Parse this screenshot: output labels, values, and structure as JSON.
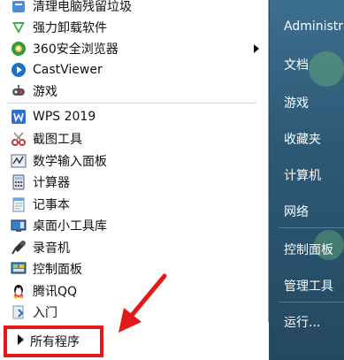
{
  "programs": [
    {
      "label": "清理电脑残留垃圾",
      "icon": "cleanup-icon"
    },
    {
      "label": "强力卸载软件",
      "icon": "uninstall-icon"
    },
    {
      "label": "360安全浏览器",
      "icon": "browser-360-icon"
    },
    {
      "label": "CastViewer",
      "icon": "castviewer-icon"
    },
    {
      "label": "游戏",
      "icon": "games-icon"
    },
    {
      "label": "WPS 2019",
      "icon": "wps-icon"
    },
    {
      "label": "截图工具",
      "icon": "snipping-tool-icon"
    },
    {
      "label": "数学输入面板",
      "icon": "math-input-icon"
    },
    {
      "label": "计算器",
      "icon": "calculator-icon"
    },
    {
      "label": "记事本",
      "icon": "notepad-icon"
    },
    {
      "label": "桌面小工具库",
      "icon": "gadgets-icon"
    },
    {
      "label": "录音机",
      "icon": "sound-recorder-icon"
    },
    {
      "label": "控制面板",
      "icon": "control-panel-icon"
    },
    {
      "label": "腾讯QQ",
      "icon": "qq-icon"
    },
    {
      "label": "入门",
      "icon": "getting-started-icon"
    }
  ],
  "all_programs_label": "所有程序",
  "right_pane": [
    "Administr",
    "文档",
    "游戏",
    "收藏夹",
    "计算机",
    "网络",
    "控制面板",
    "管理工具",
    "运行..."
  ],
  "colors": {
    "highlight": "#e51919",
    "right_pane": "#2d5976"
  }
}
